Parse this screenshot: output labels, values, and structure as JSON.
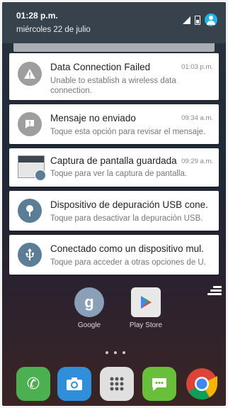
{
  "status_bar": {
    "time": "01:28 p.m.",
    "date": "miércoles 22 de julio"
  },
  "notifications": [
    {
      "icon": "warning-icon",
      "icon_bg": "#9e9e9e",
      "title": "Data Connection Failed",
      "time": "01:03 p.m.",
      "text": "Unable to establish a wireless data connection."
    },
    {
      "icon": "message-alert-icon",
      "icon_bg": "#9e9e9e",
      "title": "Mensaje no enviado",
      "time": "09:34 a.m.",
      "text": "Toque esta opción para revisar el mensaje."
    },
    {
      "icon": "screenshot-thumbnail",
      "icon_bg": "#5b7d96",
      "title": "Captura de pantalla guardada",
      "time": "09:29 a.m.",
      "text": "Toque para ver la captura de pantalla."
    },
    {
      "icon": "usb-debug-icon",
      "icon_bg": "#5b7d96",
      "title": "Dispositivo de depuración USB cone.",
      "time": "",
      "text": "Toque para desactivar la depuración USB."
    },
    {
      "icon": "usb-icon",
      "icon_bg": "#5b7d96",
      "title": "Conectado como un dispositivo mul.",
      "time": "",
      "text": "Toque para acceder a otras opciones de U."
    }
  ],
  "home_apps": [
    {
      "label": "Google",
      "icon": "google-icon"
    },
    {
      "label": "Play Store",
      "icon": "play-store-icon"
    }
  ],
  "dock": [
    {
      "icon": "phone-icon",
      "color": "#4caf50"
    },
    {
      "icon": "camera-icon",
      "color": "#2f8fd8"
    },
    {
      "icon": "app-drawer-icon",
      "color": "#e0e0e0"
    },
    {
      "icon": "messaging-icon",
      "color": "#6abf3a"
    },
    {
      "icon": "chrome-icon",
      "color": "#e8e8e8"
    }
  ]
}
